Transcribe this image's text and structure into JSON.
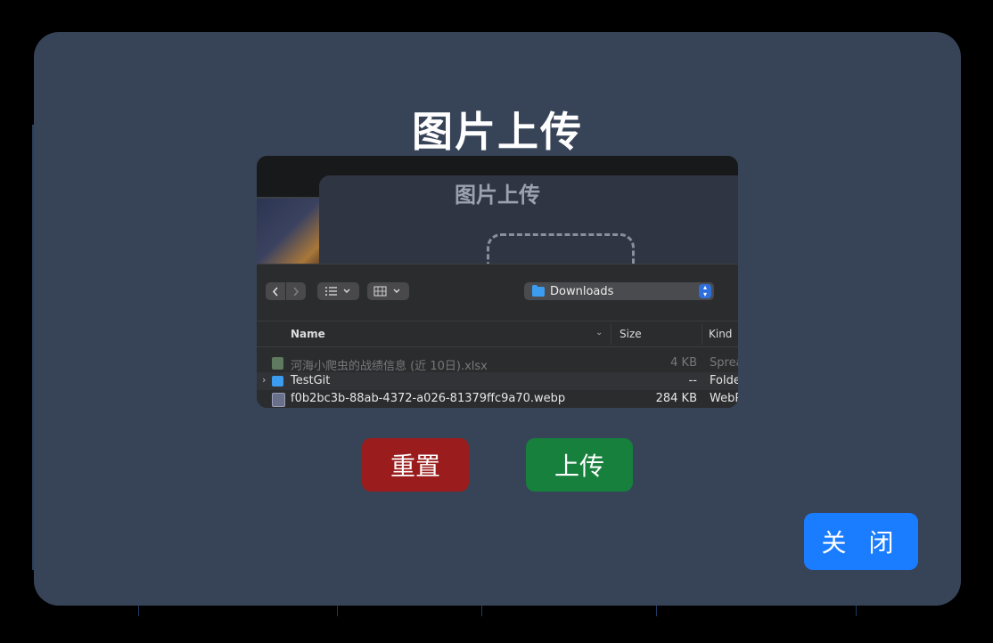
{
  "modal": {
    "title": "图片上传",
    "buttons": {
      "reset_label": "重置",
      "upload_label": "上传",
      "close_label": "关 闭"
    },
    "colors": {
      "reset": "#9a1c1c",
      "upload": "#16803c",
      "close": "#1a7cff",
      "modal_bg": "#374357"
    }
  },
  "preview": {
    "inner_title": "图片上传",
    "finder": {
      "location": "Downloads",
      "columns": {
        "name": "Name",
        "size": "Size",
        "kind": "Kind"
      },
      "rows": [
        {
          "name": "河海小爬虫的战绩信息 (近 10日).xlsx",
          "size": "4 KB",
          "kind": "Sprea",
          "icon": "spreadsheet-icon",
          "dim": true
        },
        {
          "name": "TestGit",
          "size": "--",
          "kind": "Folde",
          "icon": "folder-icon",
          "dim": false
        },
        {
          "name": "f0b2bc3b-88ab-4372-a026-81379ffc9a70.webp",
          "size": "284 KB",
          "kind": "WebP",
          "icon": "image-file-icon",
          "dim": false
        }
      ]
    }
  }
}
